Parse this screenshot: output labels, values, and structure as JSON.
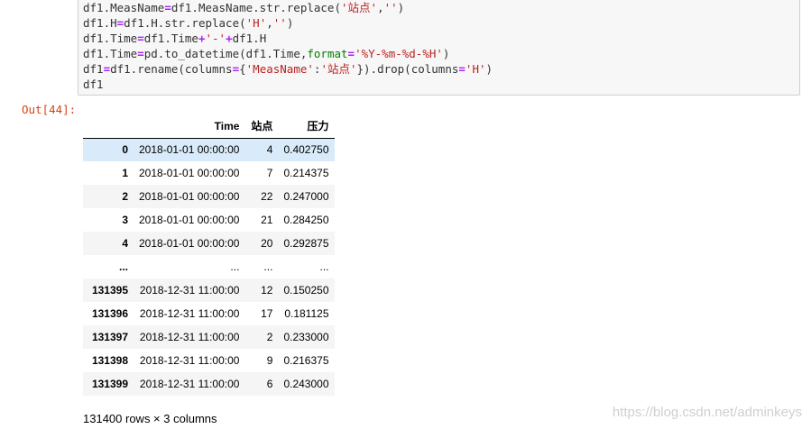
{
  "code": {
    "lines": [
      [
        {
          "t": "df1.MeasName",
          "c": ""
        },
        {
          "t": "=",
          "c": "op"
        },
        {
          "t": "df1.MeasName.str.replace(",
          "c": ""
        },
        {
          "t": "'站点'",
          "c": "str"
        },
        {
          "t": ",",
          "c": ""
        },
        {
          "t": "''",
          "c": "str"
        },
        {
          "t": ")",
          "c": ""
        }
      ],
      [
        {
          "t": "df1.H",
          "c": ""
        },
        {
          "t": "=",
          "c": "op"
        },
        {
          "t": "df1.H.str.replace(",
          "c": ""
        },
        {
          "t": "'H'",
          "c": "str"
        },
        {
          "t": ",",
          "c": ""
        },
        {
          "t": "''",
          "c": "str"
        },
        {
          "t": ")",
          "c": ""
        }
      ],
      [
        {
          "t": "df1.Time",
          "c": ""
        },
        {
          "t": "=",
          "c": "op"
        },
        {
          "t": "df1.Time",
          "c": ""
        },
        {
          "t": "+",
          "c": "op"
        },
        {
          "t": "'-'",
          "c": "str"
        },
        {
          "t": "+",
          "c": "op"
        },
        {
          "t": "df1.H",
          "c": ""
        }
      ],
      [
        {
          "t": "df1.Time",
          "c": ""
        },
        {
          "t": "=",
          "c": "op"
        },
        {
          "t": "pd.to_datetime(df1.Time,",
          "c": ""
        },
        {
          "t": "format",
          "c": "kw"
        },
        {
          "t": "=",
          "c": "op"
        },
        {
          "t": "'%Y-%m-%d-%H'",
          "c": "str"
        },
        {
          "t": ")",
          "c": ""
        }
      ],
      [
        {
          "t": "df1",
          "c": ""
        },
        {
          "t": "=",
          "c": "op"
        },
        {
          "t": "df1.rename(columns",
          "c": ""
        },
        {
          "t": "=",
          "c": "op"
        },
        {
          "t": "{",
          "c": ""
        },
        {
          "t": "'MeasName'",
          "c": "str"
        },
        {
          "t": ":",
          "c": ""
        },
        {
          "t": "'站点'",
          "c": "str"
        },
        {
          "t": "}).drop(columns",
          "c": ""
        },
        {
          "t": "=",
          "c": "op"
        },
        {
          "t": "'H'",
          "c": "str"
        },
        {
          "t": ")",
          "c": ""
        }
      ],
      [
        {
          "t": "df1",
          "c": ""
        }
      ]
    ]
  },
  "output": {
    "prompt": "Out[44]:",
    "columns": [
      "",
      "Time",
      "站点",
      "压力"
    ],
    "rows": [
      [
        "0",
        "2018-01-01 00:00:00",
        "4",
        "0.402750"
      ],
      [
        "1",
        "2018-01-01 00:00:00",
        "7",
        "0.214375"
      ],
      [
        "2",
        "2018-01-01 00:00:00",
        "22",
        "0.247000"
      ],
      [
        "3",
        "2018-01-01 00:00:00",
        "21",
        "0.284250"
      ],
      [
        "4",
        "2018-01-01 00:00:00",
        "20",
        "0.292875"
      ],
      [
        "...",
        "...",
        "...",
        "..."
      ],
      [
        "131395",
        "2018-12-31 11:00:00",
        "12",
        "0.150250"
      ],
      [
        "131396",
        "2018-12-31 11:00:00",
        "17",
        "0.181125"
      ],
      [
        "131397",
        "2018-12-31 11:00:00",
        "2",
        "0.233000"
      ],
      [
        "131398",
        "2018-12-31 11:00:00",
        "9",
        "0.216375"
      ],
      [
        "131399",
        "2018-12-31 11:00:00",
        "6",
        "0.243000"
      ]
    ],
    "highlighted_row": 0,
    "shape_text": "131400 rows × 3 columns"
  },
  "watermark": "https://blog.csdn.net/adminkeys",
  "colors": {
    "string": "#ba2121",
    "operator": "#aa22ff",
    "keyword": "#008000",
    "prompt": "#d84315",
    "row_highlight": "#d9ebfa"
  }
}
